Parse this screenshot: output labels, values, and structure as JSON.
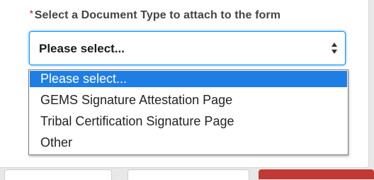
{
  "form": {
    "required_marker": "*",
    "label": "Select a Document Type to attach to the form",
    "select": {
      "value": "Please select..."
    },
    "options": [
      "Please select...",
      "GEMS Signature Attestation Page",
      "Tribal Certification Signature Page",
      "Other"
    ],
    "highlighted_option": "Please select..."
  },
  "colors": {
    "required": "#c23934",
    "focus_border": "#1b96ff",
    "highlight": "#1e7ee6",
    "danger_button": "#c23934"
  }
}
